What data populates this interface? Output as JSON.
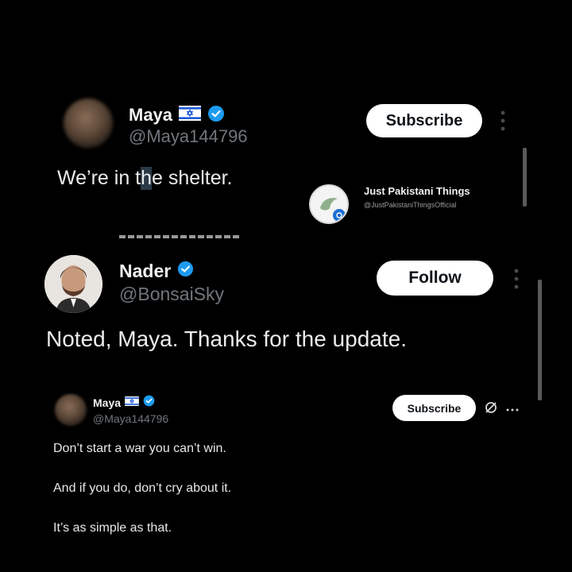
{
  "tweet1": {
    "name": "Maya",
    "handle": "@Maya144796",
    "text_before": "We’re in t",
    "text_sel": "h",
    "text_after": "e shelter.",
    "button": "Subscribe"
  },
  "overlay": {
    "name": "Just Pakistani Things",
    "handle": "@JustPakistaniThingsOfficial"
  },
  "tweet2": {
    "name": "Nader",
    "handle": "@BonsaiSky",
    "text": "Noted, Maya. Thanks for the update.",
    "button": "Follow"
  },
  "tweet3": {
    "name": "Maya",
    "handle": "@Maya144796",
    "button": "Subscribe",
    "lines": [
      "Don’t start a war you can’t win.",
      "And if you do, don’t cry about it.",
      "It’s as simple as that."
    ]
  },
  "colors": {
    "verified": "#1d9bf0",
    "background": "#000000",
    "handle": "#71767b"
  }
}
